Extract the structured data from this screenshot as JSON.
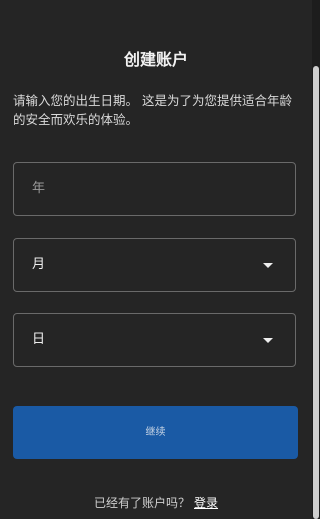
{
  "title": "创建账户",
  "description": "请输入您的出生日期。 这是为了为您提供适合年龄的安全而欢乐的体验。",
  "fields": {
    "year": {
      "placeholder": "年"
    },
    "month": {
      "value": "月"
    },
    "day": {
      "value": "日"
    }
  },
  "continue_label": "继续",
  "footer": {
    "text": "已经有了账户吗？",
    "link": "登录"
  },
  "colors": {
    "background": "#252525",
    "button": "#1a5aa5",
    "field_border": "#6a6a6a"
  },
  "icons": {
    "dropdown": "chevron-down-icon"
  }
}
